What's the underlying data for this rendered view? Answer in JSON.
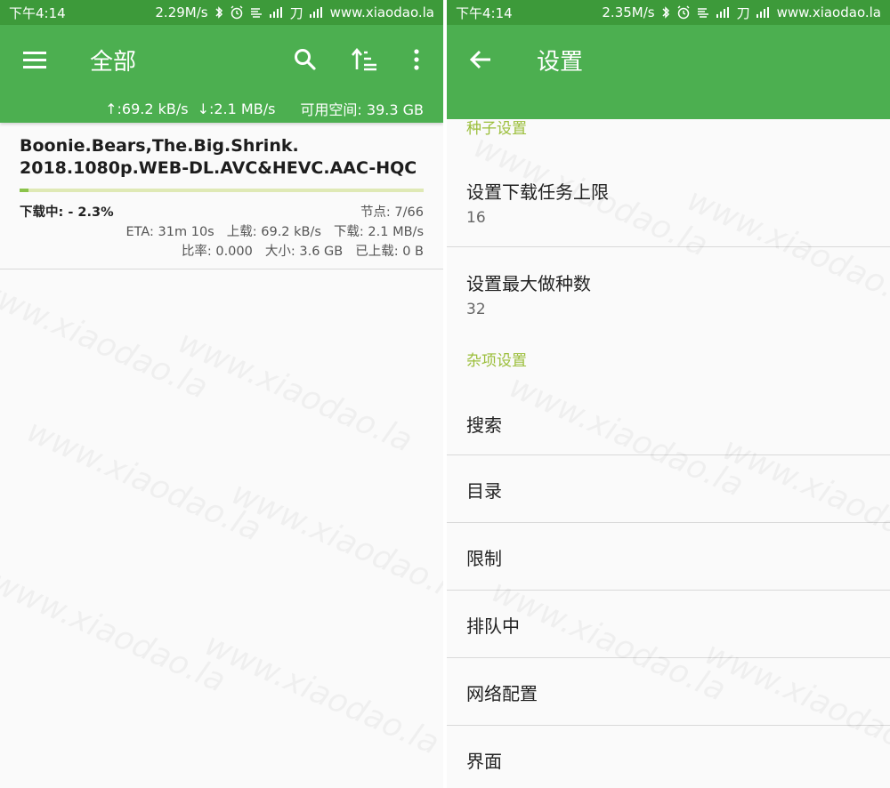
{
  "watermark": "www.xiaodao.la",
  "colors": {
    "status_bar": "#3d9a3a",
    "app_bar": "#4caf50",
    "progress_fill": "#8bc34a",
    "progress_track": "#dfe9b5",
    "section_header": "#9bbe3a"
  },
  "left": {
    "status_bar": {
      "time": "下午4:14",
      "net_speed": "2.29M/s",
      "carrier": "刀",
      "site": "www.xiaodao.la"
    },
    "app_bar": {
      "title": "全部",
      "menu_icon": "menu-icon",
      "search_icon": "search-icon",
      "sort_icon": "sort-icon",
      "more_icon": "more-vert-icon",
      "upload_speed": "↑:69.2 kB/s",
      "download_speed": "↓:2.1 MB/s",
      "free_space": "可用空间: 39.3 GB"
    },
    "torrent": {
      "name_line1": "Boonie.Bears,The.Big.Shrink.",
      "name_line2": "2018.1080p.WEB-DL.AVC&HEVC.AAC-HQC",
      "progress": 0.023,
      "status": "下载中: - 2.3%",
      "peers": "节点: 7/66",
      "eta": "ETA: 31m 10s",
      "upload": "上载: 69.2 kB/s",
      "download": "下载: 2.1 MB/s",
      "ratio": "比率: 0.000",
      "size": "大小: 3.6 GB",
      "uploaded": "已上载: 0 B"
    }
  },
  "right": {
    "status_bar": {
      "time": "下午4:14",
      "net_speed": "2.35M/s",
      "carrier": "刀",
      "site": "www.xiaodao.la"
    },
    "app_bar": {
      "title": "设置",
      "back_icon": "arrow-back-icon"
    },
    "sections": {
      "torrent_settings": "种子设置",
      "misc_settings": "杂项设置"
    },
    "prefs": {
      "max_downloads": {
        "title": "设置下载任务上限",
        "value": "16"
      },
      "max_seeds": {
        "title": "设置最大做种数",
        "value": "32"
      },
      "search": "搜索",
      "directories": "目录",
      "limits": "限制",
      "queueing": "排队中",
      "network": "网络配置",
      "interface": "界面"
    }
  }
}
